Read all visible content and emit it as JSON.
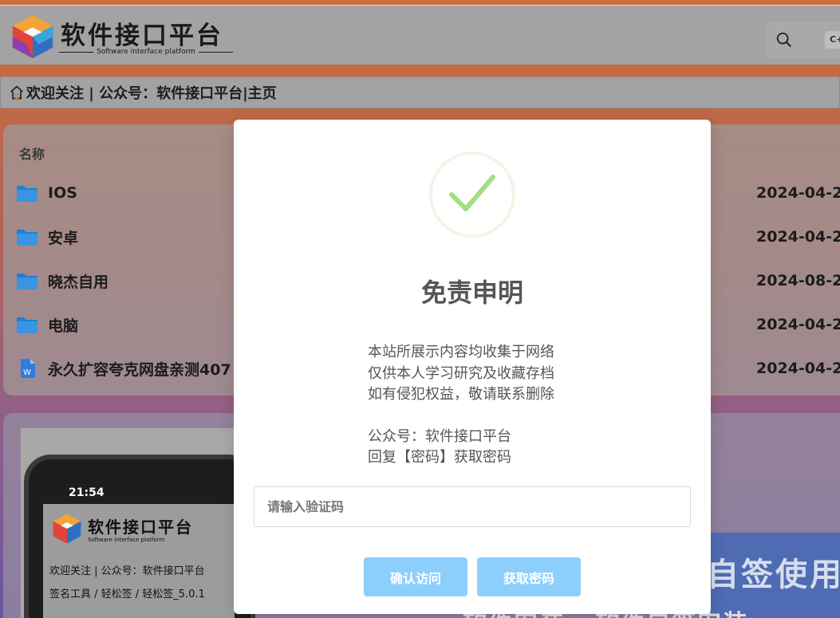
{
  "site": {
    "title": "软件接口平台",
    "subtitle": "Software interface platform",
    "search_shortcut": "C+"
  },
  "breadcrumb": "欢迎关注 | 公众号：软件接口平台|主页",
  "file_list": {
    "column_name": "名称",
    "rows": [
      {
        "name": "IOS",
        "date": "2024-04-2",
        "type": "folder"
      },
      {
        "name": "安卓",
        "date": "2024-04-2",
        "type": "folder"
      },
      {
        "name": "晓杰自用",
        "date": "2024-08-2",
        "type": "folder"
      },
      {
        "name": "电脑",
        "date": "2024-04-2",
        "type": "folder"
      },
      {
        "name": "永久扩容夸克网盘亲测407",
        "date": "2024-04-2",
        "type": "word"
      }
    ]
  },
  "preview": {
    "time": "21:54",
    "mini_title": "软件接口平台",
    "mini_subtitle": "Software interface platform",
    "mini_breadcrumb": "欢迎关注 | 公众号：软件接口平台",
    "mini_path": "签名工具 / 轻松签 / 轻松签_5.0.1",
    "right_promo": "自签使用",
    "bottom_promo": "软件安装 · 软件自签安装"
  },
  "modal": {
    "title": "免责申明",
    "lines_a": [
      "本站所展示内容均收集于网络",
      "仅供本人学习研究及收藏存档",
      "如有侵犯权益，敬请联系删除"
    ],
    "lines_b": [
      "公众号：软件接口平台",
      "回复【密码】获取密码"
    ],
    "input_placeholder": "请输入验证码",
    "input_value": "",
    "confirm_label": "确认访问",
    "get_password_label": "获取密码"
  },
  "colors": {
    "button_bg": "#8dcffc",
    "check_green": "#a5dc86",
    "folder_blue": "#1e7fd6"
  }
}
